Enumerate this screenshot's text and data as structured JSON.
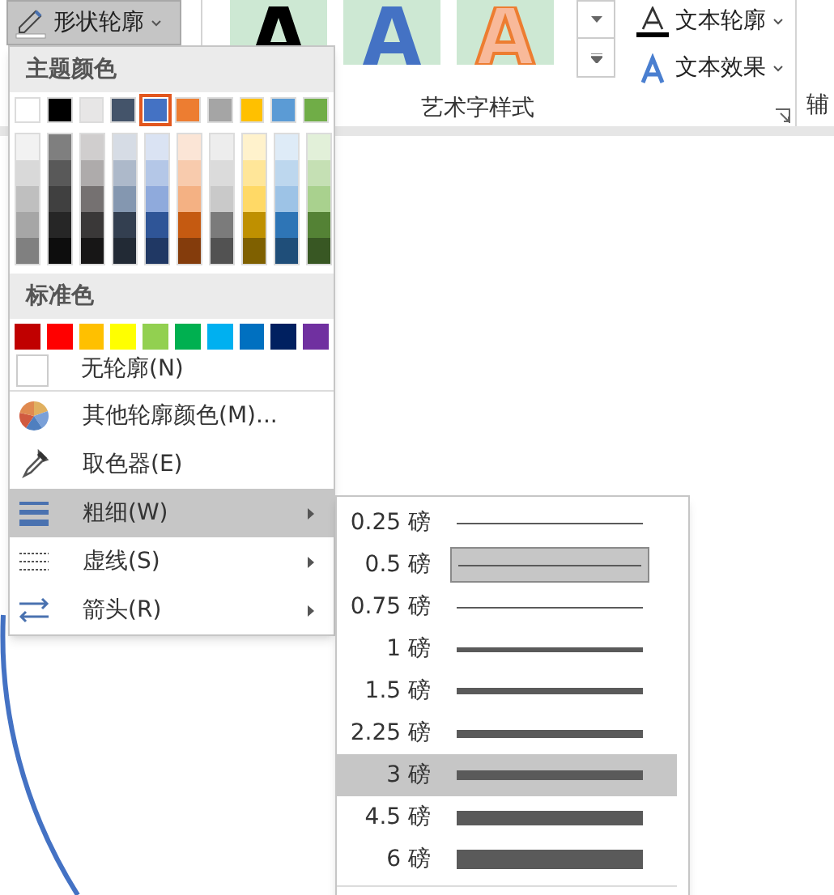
{
  "ribbon": {
    "shape_outline_button": {
      "label": "形状轮廓",
      "pressed": true
    },
    "wordart_samples": [
      {
        "kind": "black"
      },
      {
        "kind": "blue"
      },
      {
        "kind": "orange"
      }
    ],
    "text_buttons": [
      {
        "label": "文本轮廓",
        "kind": "outline"
      },
      {
        "label": "文本效果",
        "kind": "effect"
      }
    ],
    "group_label": "艺术字样式",
    "next_group_label": "辅"
  },
  "menu": {
    "theme_header": "主题颜色",
    "theme_colors": [
      {
        "color": "#ffffff",
        "selected": false
      },
      {
        "color": "#000000",
        "selected": false
      },
      {
        "color": "#e7e6e6",
        "selected": false
      },
      {
        "color": "#44546a",
        "selected": false
      },
      {
        "color": "#4472c4",
        "selected": true
      },
      {
        "color": "#ed7d31",
        "selected": false
      },
      {
        "color": "#a5a5a5",
        "selected": false
      },
      {
        "color": "#ffc000",
        "selected": false
      },
      {
        "color": "#5b9bd5",
        "selected": false
      },
      {
        "color": "#70ad47",
        "selected": false
      }
    ],
    "shades": [
      {
        "colors": [
          {
            "color": "#f2f2f2"
          },
          {
            "color": "#d9d9d9"
          },
          {
            "color": "#bfbfbf"
          },
          {
            "color": "#a6a6a6"
          },
          {
            "color": "#808080"
          }
        ]
      },
      {
        "colors": [
          {
            "color": "#7f7f7f"
          },
          {
            "color": "#595959"
          },
          {
            "color": "#404040"
          },
          {
            "color": "#262626"
          },
          {
            "color": "#0d0d0d"
          }
        ]
      },
      {
        "colors": [
          {
            "color": "#d0cece"
          },
          {
            "color": "#aeabab"
          },
          {
            "color": "#757171"
          },
          {
            "color": "#3a3838"
          },
          {
            "color": "#171616"
          }
        ]
      },
      {
        "colors": [
          {
            "color": "#d6dce5"
          },
          {
            "color": "#adb9ca"
          },
          {
            "color": "#8497b0"
          },
          {
            "color": "#333f50"
          },
          {
            "color": "#222a35"
          }
        ]
      },
      {
        "colors": [
          {
            "color": "#dae3f3"
          },
          {
            "color": "#b4c7e7"
          },
          {
            "color": "#8faadc"
          },
          {
            "color": "#2f5597"
          },
          {
            "color": "#203864"
          }
        ]
      },
      {
        "colors": [
          {
            "color": "#fbe5d6"
          },
          {
            "color": "#f8cbad"
          },
          {
            "color": "#f4b183"
          },
          {
            "color": "#c55a11"
          },
          {
            "color": "#843c0c"
          }
        ]
      },
      {
        "colors": [
          {
            "color": "#ededed"
          },
          {
            "color": "#dbdbdb"
          },
          {
            "color": "#c9c9c9"
          },
          {
            "color": "#7b7b7b"
          },
          {
            "color": "#525252"
          }
        ]
      },
      {
        "colors": [
          {
            "color": "#fff2cc"
          },
          {
            "color": "#ffe699"
          },
          {
            "color": "#ffd966"
          },
          {
            "color": "#bf9000"
          },
          {
            "color": "#7f6000"
          }
        ]
      },
      {
        "colors": [
          {
            "color": "#deebf7"
          },
          {
            "color": "#bdd7ee"
          },
          {
            "color": "#9dc3e6"
          },
          {
            "color": "#2e75b6"
          },
          {
            "color": "#1f4e79"
          }
        ]
      },
      {
        "colors": [
          {
            "color": "#e2f0d9"
          },
          {
            "color": "#c5e0b4"
          },
          {
            "color": "#a9d18e"
          },
          {
            "color": "#548235"
          },
          {
            "color": "#385723"
          }
        ]
      }
    ],
    "standard_header": "标准色",
    "standard_colors": [
      {
        "color": "#c00000"
      },
      {
        "color": "#ff0000"
      },
      {
        "color": "#ffc000"
      },
      {
        "color": "#ffff00"
      },
      {
        "color": "#92d050"
      },
      {
        "color": "#00b050"
      },
      {
        "color": "#00b0f0"
      },
      {
        "color": "#0070c0"
      },
      {
        "color": "#002060"
      },
      {
        "color": "#7030a0"
      }
    ],
    "no_outline": {
      "label": "无轮廓(N)"
    },
    "items": [
      {
        "label": "其他轮廓颜色(M)...",
        "kind": "palette",
        "submenu": false,
        "selected": false
      },
      {
        "label": "取色器(E)",
        "kind": "eyedropper",
        "submenu": false,
        "selected": false
      },
      {
        "label": "粗细(W)",
        "kind": "weight",
        "submenu": true,
        "selected": true
      },
      {
        "label": "虚线(S)",
        "kind": "dash",
        "submenu": true,
        "selected": false
      },
      {
        "label": "箭头(R)",
        "kind": "arrow",
        "submenu": true,
        "selected": false
      }
    ]
  },
  "weight_menu": [
    {
      "label": "0.25 磅",
      "current": false,
      "selected": false
    },
    {
      "label": "0.5 磅",
      "current": true,
      "selected": false
    },
    {
      "label": "0.75 磅",
      "current": false,
      "selected": false
    },
    {
      "label": "1 磅",
      "current": false,
      "selected": false
    },
    {
      "label": "1.5 磅",
      "current": false,
      "selected": false
    },
    {
      "label": "2.25 磅",
      "current": false,
      "selected": false
    },
    {
      "label": "3 磅",
      "current": false,
      "selected": true
    },
    {
      "label": "4.5 磅",
      "current": false,
      "selected": false
    },
    {
      "label": "6 磅",
      "current": false,
      "selected": false
    }
  ]
}
